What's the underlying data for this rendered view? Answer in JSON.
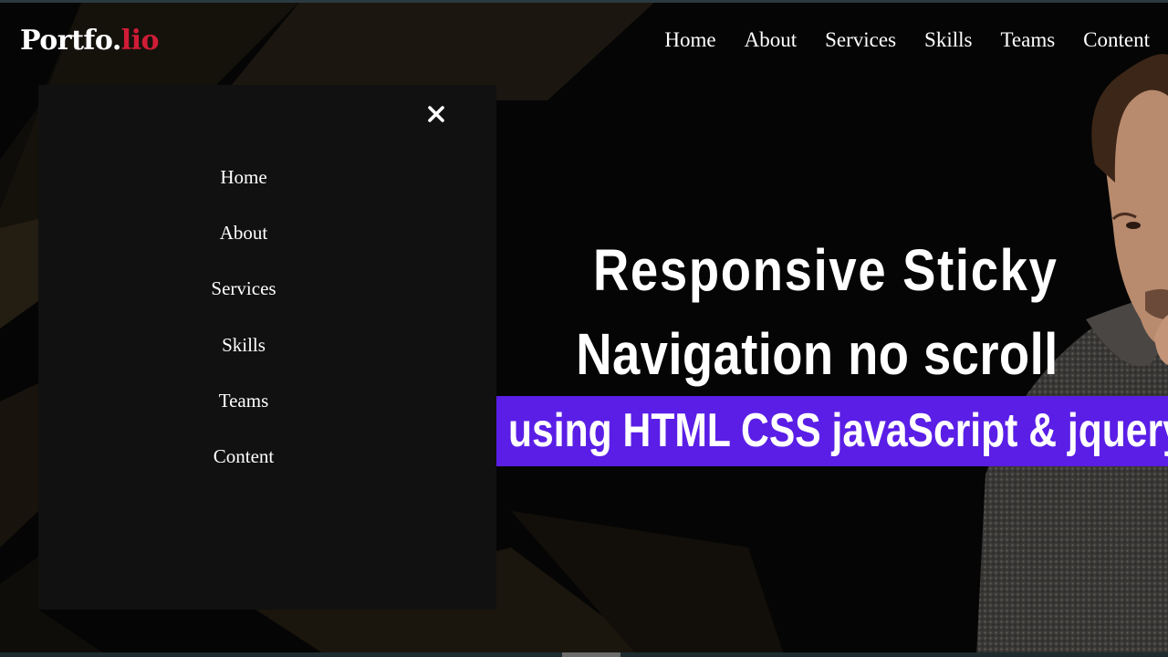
{
  "brand": {
    "logo_main": "Portfo.",
    "logo_accent": "lio",
    "accent_color": "#d01c36"
  },
  "topnav": {
    "items": [
      "Home",
      "About",
      "Services",
      "Skills",
      "Teams",
      "Content"
    ]
  },
  "drawer": {
    "close_icon": "close-icon",
    "items": [
      "Home",
      "About",
      "Services",
      "Skills",
      "Teams",
      "Content"
    ]
  },
  "hero": {
    "line1": "Responsive  Sticky",
    "line2": "Navigation no scroll",
    "banner": "using HTML CSS  javaScript & jquery",
    "banner_color": "#5a1ee6"
  }
}
